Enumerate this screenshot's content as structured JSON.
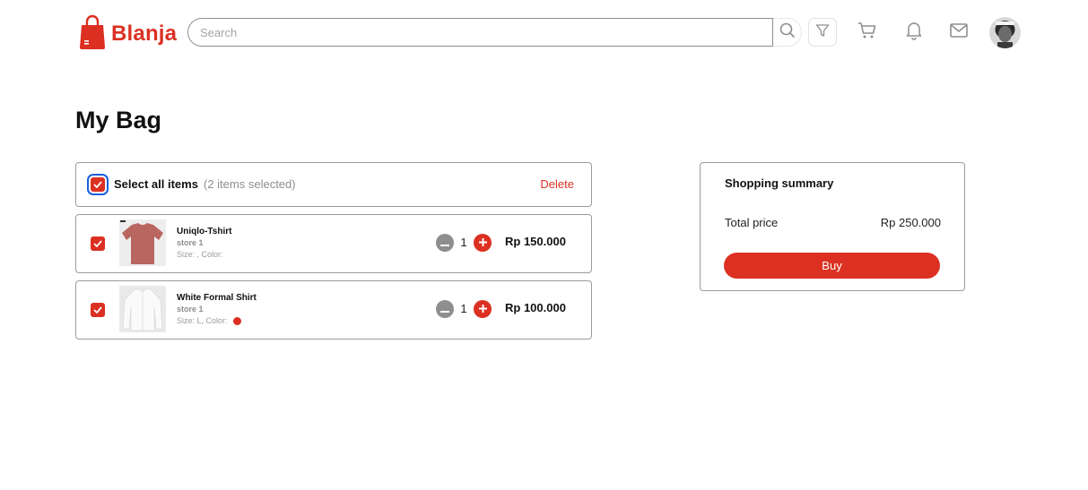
{
  "header": {
    "brand": "Blanja",
    "search": {
      "placeholder": "Search",
      "value": ""
    },
    "icons": [
      "search-icon",
      "filter-icon",
      "cart-icon",
      "bell-icon",
      "mail-icon"
    ],
    "accent_color": "#DB3022"
  },
  "page": {
    "title": "My Bag"
  },
  "bag": {
    "select_all_label": "Select all items",
    "selected_count_text": "(2 items selected)",
    "delete_label": "Delete",
    "items": [
      {
        "name": "Uniqlo-Tshirt",
        "store": "store 1",
        "meta_text": "Size: ,  Color:",
        "has_color_dot": false,
        "quantity": "1",
        "price": "Rp 150.000",
        "checked": true,
        "thumb_color": "#b96560"
      },
      {
        "name": "White Formal Shirt",
        "store": "store 1",
        "meta_text": "Size: L,  Color:",
        "has_color_dot": true,
        "dot_color": "#DB3022",
        "quantity": "1",
        "price": "Rp 100.000",
        "checked": true,
        "thumb_color": "#f5f5f5"
      }
    ]
  },
  "summary": {
    "title": "Shopping summary",
    "total_label": "Total price",
    "total_value": "Rp 250.000",
    "buy_label": "Buy"
  }
}
